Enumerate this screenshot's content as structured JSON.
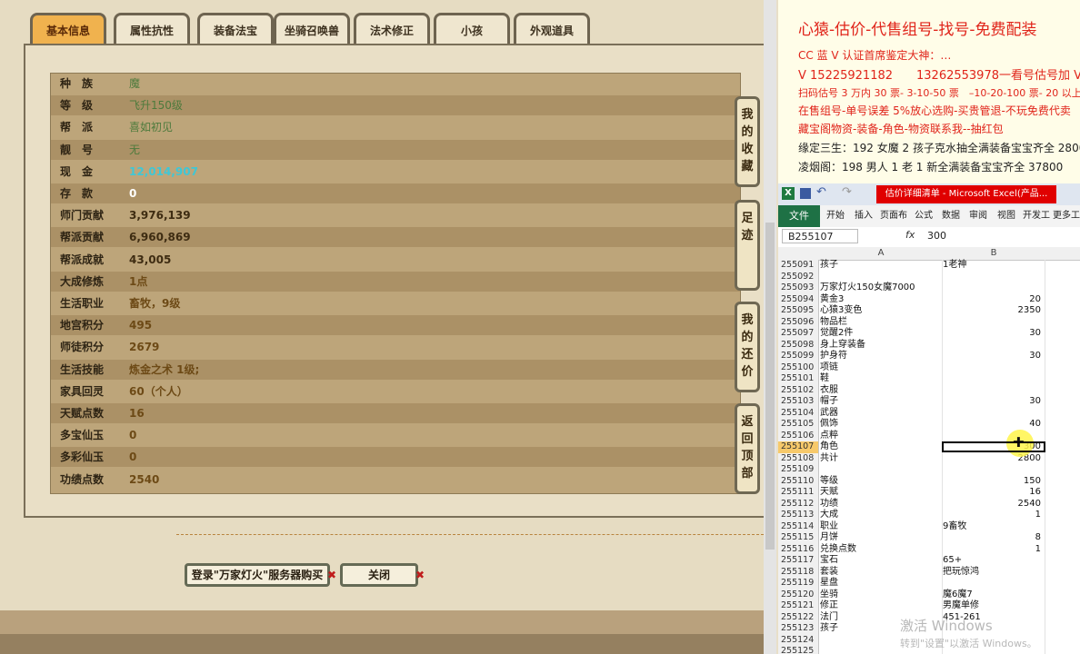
{
  "game": {
    "tabs": [
      "基本信息",
      "属性抗性",
      "装备法宝",
      "坐骑召唤兽",
      "法术修正",
      "小孩",
      "外观道具"
    ],
    "rows": [
      {
        "label": "种　族",
        "value": "魔",
        "style": "green"
      },
      {
        "label": "等　级",
        "value": "飞升150级",
        "style": "green"
      },
      {
        "label": "帮　派",
        "value": "喜如初见",
        "style": "green"
      },
      {
        "label": "靓　号",
        "value": "无",
        "style": "green"
      },
      {
        "label": "现　金",
        "value": "12,014,907",
        "style": "cyan"
      },
      {
        "label": "存　款",
        "value": "0",
        "style": "white"
      },
      {
        "label": "师门贡献",
        "value": "3,976,139",
        "style": "normal"
      },
      {
        "label": "帮派贡献",
        "value": "6,960,869",
        "style": "normal"
      },
      {
        "label": "帮派成就",
        "value": "43,005",
        "style": "normal"
      },
      {
        "label": "大成修炼",
        "value": "1点",
        "style": "brown"
      },
      {
        "label": "生活职业",
        "value": "畜牧，9级",
        "style": "brown"
      },
      {
        "label": "地宫积分",
        "value": "495",
        "style": "brown"
      },
      {
        "label": "师徒积分",
        "value": "2679",
        "style": "brown"
      },
      {
        "label": "生活技能",
        "value": "炼金之术 1级;",
        "style": "brown"
      },
      {
        "label": "家具回灵",
        "value": "60（个人）",
        "style": "brown"
      },
      {
        "label": "天赋点数",
        "value": "16",
        "style": "brown"
      },
      {
        "label": "多宝仙玉",
        "value": "0",
        "style": "brown"
      },
      {
        "label": "多彩仙玉",
        "value": "0",
        "style": "brown"
      },
      {
        "label": "功绩点数",
        "value": "2540",
        "style": "brown"
      }
    ],
    "side_buttons": [
      "我的收藏",
      "足迹",
      "我的还价",
      "返回顶部"
    ],
    "login_button": "登录\"万家灯火\"服务器购买",
    "close_button": "关闭"
  },
  "doc": {
    "heading": "心猿-估价-代售组号-找号-免费配装",
    "lines": [
      {
        "text": "CC 蓝 V 认证首席鉴定大神：…",
        "color": "red"
      },
      {
        "text": "V 15225921182　　13262553978一看号估号加 V",
        "color": "red"
      },
      {
        "text": "扫码估号 3 万内 30 票- 3-10-50 票　–10-20-100 票- 20 以上 150",
        "color": "red"
      },
      {
        "text": "在售组号-单号误差 5%放心选购-买贵管退-不玩免费代卖",
        "color": "red"
      },
      {
        "text": "藏宝阁物资-装备-角色-物资联系我--抽红包",
        "color": "red"
      },
      {
        "text": "缘定三生：192 女魔 2 孩子克水抽全满装备宝宝齐全 28000",
        "color": "black"
      },
      {
        "text": "凌烟阁：198 男人 1 老 1 新全满装备宝宝齐全 37800",
        "color": "black"
      }
    ]
  },
  "excel": {
    "title": "估价详细清单 - Microsoft Excel(产品...",
    "ribbon_tabs": [
      "文件",
      "开始",
      "插入",
      "页面布",
      "公式",
      "数据",
      "审阅",
      "视图",
      "开发工",
      "更多工"
    ],
    "name_box": "B255107",
    "fx_label": "fx",
    "formula_value": "300",
    "col_a": "A",
    "col_b": "B",
    "rows": [
      {
        "n": "255091",
        "a": "孩子",
        "b": "1老神"
      },
      {
        "n": "255092",
        "a": "",
        "b": ""
      },
      {
        "n": "255093",
        "a": "万家灯火150女魔7000",
        "b": ""
      },
      {
        "n": "255094",
        "a": "黄金3",
        "b": "20"
      },
      {
        "n": "255095",
        "a": "心猿3变色",
        "b": "2350"
      },
      {
        "n": "255096",
        "a": "物品栏",
        "b": ""
      },
      {
        "n": "255097",
        "a": "觉醒2件",
        "b": "30"
      },
      {
        "n": "255098",
        "a": "身上穿装备",
        "b": ""
      },
      {
        "n": "255099",
        "a": "护身符",
        "b": "30"
      },
      {
        "n": "255100",
        "a": "项链",
        "b": ""
      },
      {
        "n": "255101",
        "a": "鞋",
        "b": ""
      },
      {
        "n": "255102",
        "a": "衣服",
        "b": ""
      },
      {
        "n": "255103",
        "a": "帽子",
        "b": "30"
      },
      {
        "n": "255104",
        "a": "武器",
        "b": ""
      },
      {
        "n": "255105",
        "a": "佩饰",
        "b": "40"
      },
      {
        "n": "255106",
        "a": "点粹",
        "b": ""
      },
      {
        "n": "255107",
        "a": "角色",
        "b": "300"
      },
      {
        "n": "255108",
        "a": "共计",
        "b": "2800"
      },
      {
        "n": "255109",
        "a": "",
        "b": ""
      },
      {
        "n": "255110",
        "a": "等级",
        "b": "150"
      },
      {
        "n": "255111",
        "a": "天赋",
        "b": "16"
      },
      {
        "n": "255112",
        "a": "功绩",
        "b": "2540"
      },
      {
        "n": "255113",
        "a": "大成",
        "b": "1"
      },
      {
        "n": "255114",
        "a": "职业",
        "b": "9畜牧"
      },
      {
        "n": "255115",
        "a": "月饼",
        "b": "8"
      },
      {
        "n": "255116",
        "a": "兑换点数",
        "b": "1"
      },
      {
        "n": "255117",
        "a": "宝石",
        "b": "65+"
      },
      {
        "n": "255118",
        "a": "套装",
        "b": "把玩惊鸿"
      },
      {
        "n": "255119",
        "a": "星盘",
        "b": ""
      },
      {
        "n": "255120",
        "a": "坐骑",
        "b": "魔6魔7"
      },
      {
        "n": "255121",
        "a": "修正",
        "b": "男魔单修"
      },
      {
        "n": "255122",
        "a": "法门",
        "b": "451-261"
      },
      {
        "n": "255123",
        "a": "孩子",
        "b": ""
      },
      {
        "n": "255124",
        "a": "",
        "b": ""
      },
      {
        "n": "255125",
        "a": "",
        "b": ""
      }
    ],
    "selected_row": "255107",
    "watermark": "激活 Windows",
    "watermark_sub": "转到\"设置\"以激活 Windows。"
  }
}
